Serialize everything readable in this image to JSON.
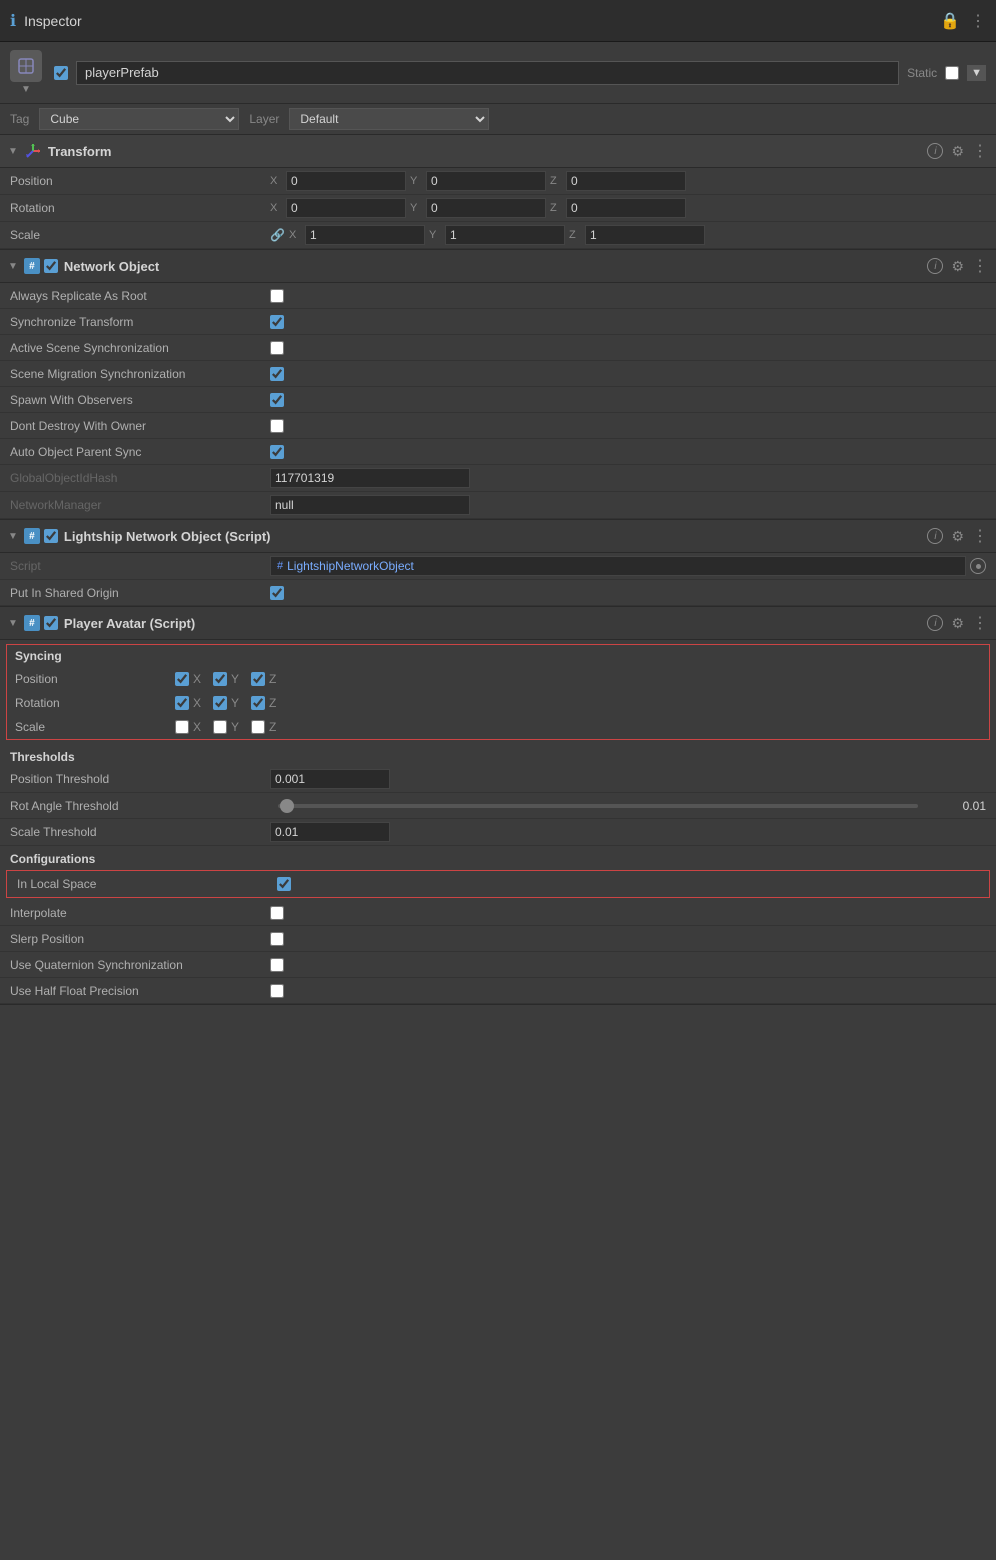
{
  "header": {
    "title": "Inspector",
    "lock_icon": "🔒",
    "more_icon": "⋮"
  },
  "object": {
    "name": "playerPrefab",
    "static_label": "Static",
    "tag_label": "Tag",
    "tag_value": "Cube",
    "layer_label": "Layer",
    "layer_value": "Default"
  },
  "transform": {
    "title": "Transform",
    "position_label": "Position",
    "position_x": "0",
    "position_y": "0",
    "position_z": "0",
    "rotation_label": "Rotation",
    "rotation_x": "0",
    "rotation_y": "0",
    "rotation_z": "0",
    "scale_label": "Scale",
    "scale_x": "1",
    "scale_y": "1",
    "scale_z": "1"
  },
  "network_object": {
    "title": "Network Object",
    "always_replicate_label": "Always Replicate As Root",
    "always_replicate_checked": false,
    "sync_transform_label": "Synchronize Transform",
    "sync_transform_checked": true,
    "active_scene_label": "Active Scene Synchronization",
    "active_scene_checked": false,
    "scene_migration_label": "Scene Migration Synchronization",
    "scene_migration_checked": true,
    "spawn_observers_label": "Spawn With Observers",
    "spawn_observers_checked": true,
    "dont_destroy_label": "Dont Destroy With Owner",
    "dont_destroy_checked": false,
    "auto_object_label": "Auto Object Parent Sync",
    "auto_object_checked": true,
    "global_id_label": "GlobalObjectIdHash",
    "global_id_value": "117701319",
    "network_manager_label": "NetworkManager",
    "network_manager_value": "null"
  },
  "lightship_network": {
    "title": "Lightship Network Object (Script)",
    "script_label": "Script",
    "script_value": "LightshipNetworkObject",
    "put_shared_label": "Put In Shared Origin",
    "put_shared_checked": true
  },
  "player_avatar": {
    "title": "Player Avatar (Script)",
    "syncing_title": "Syncing",
    "position_label": "Position",
    "position_x_checked": true,
    "position_y_checked": true,
    "position_z_checked": true,
    "rotation_label": "Rotation",
    "rotation_x_checked": true,
    "rotation_y_checked": true,
    "rotation_z_checked": true,
    "scale_label": "Scale",
    "scale_x_checked": false,
    "scale_y_checked": false,
    "scale_z_checked": false,
    "thresholds_title": "Thresholds",
    "position_threshold_label": "Position Threshold",
    "position_threshold_value": "0.001",
    "rot_angle_label": "Rot Angle Threshold",
    "rot_angle_value": "0.01",
    "scale_threshold_label": "Scale Threshold",
    "scale_threshold_value": "0.01",
    "configurations_title": "Configurations",
    "local_space_label": "In Local Space",
    "local_space_checked": true,
    "interpolate_label": "Interpolate",
    "interpolate_checked": false,
    "slerp_label": "Slerp Position",
    "slerp_checked": false,
    "use_quaternion_label": "Use Quaternion Synchronization",
    "use_quaternion_checked": false,
    "use_half_float_label": "Use Half Float Precision",
    "use_half_float_checked": false,
    "x_label": "X",
    "y_label": "Y",
    "z_label": "Z"
  }
}
